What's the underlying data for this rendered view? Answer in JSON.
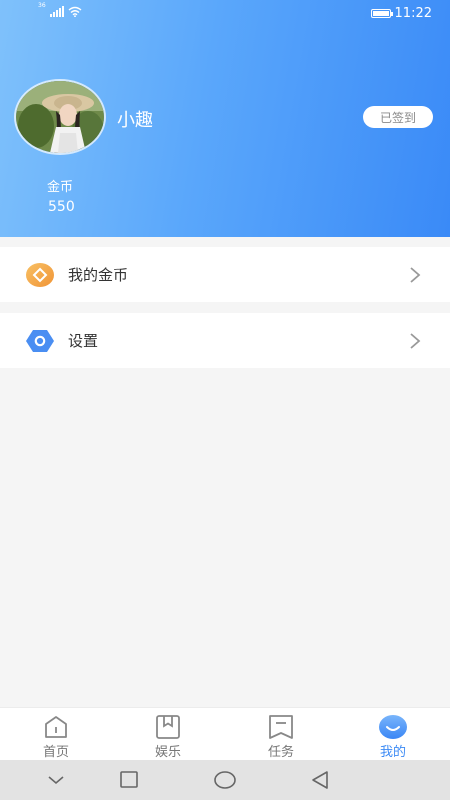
{
  "status_bar": {
    "network": "36",
    "time": "11:22",
    "icons": [
      "signal-icon",
      "wifi-icon",
      "battery-icon"
    ]
  },
  "profile": {
    "username": "小趣",
    "sign_in_label": "已签到",
    "coins_label": "金币",
    "coins_value": "550",
    "avatar": "avatar-photo"
  },
  "menu": {
    "items": [
      {
        "label": "我的金币",
        "icon": "coin-icon"
      },
      {
        "label": "设置",
        "icon": "settings-icon"
      }
    ]
  },
  "tabbar": {
    "tabs": [
      {
        "label": "首页",
        "icon": "home-icon"
      },
      {
        "label": "娱乐",
        "icon": "bookmark-icon"
      },
      {
        "label": "任务",
        "icon": "task-icon"
      },
      {
        "label": "我的",
        "icon": "profile-icon",
        "active": true
      }
    ]
  },
  "colors": {
    "header_gradient_start": "#7fc1fb",
    "header_gradient_end": "#3a8af7",
    "accent": "#3d8bf5",
    "coin_orange": "#f5a044",
    "settings_blue": "#4a8ef2"
  }
}
